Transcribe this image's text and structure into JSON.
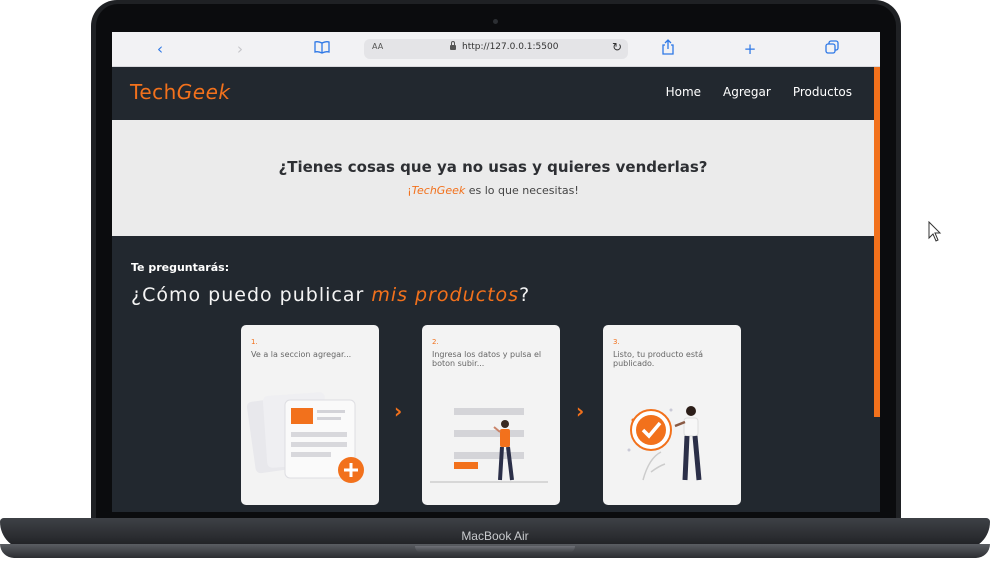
{
  "device": {
    "model_label": "MacBook Air"
  },
  "browser": {
    "url": "http://127.0.0.1:5500",
    "text_size_label": "AA",
    "icons": [
      "back-icon",
      "forward-icon",
      "book-icon",
      "lock-icon",
      "reload-icon",
      "share-icon",
      "new-tab-icon",
      "tabs-icon"
    ]
  },
  "site": {
    "logo_regular": "Tech",
    "logo_italic": "Geek",
    "nav": [
      "Home",
      "Agregar",
      "Productos"
    ],
    "hero": {
      "title": "¿Tienes cosas que ya no usas y quieres venderlas?",
      "sub_prefix": "¡",
      "sub_brand": "TechGeek",
      "sub_suffix": " es lo que necesitas!"
    },
    "section": {
      "kicker": "Te preguntarás:",
      "question_start": "¿Cómo puedo publicar ",
      "question_highlight": "mis productos",
      "question_end": "?"
    },
    "steps": [
      {
        "number": "1.",
        "text": "Ve a la seccion agregar..."
      },
      {
        "number": "2.",
        "text": "Ingresa los datos y pulsa el boton subir..."
      },
      {
        "number": "3.",
        "text": "Listo, tu producto está publicado."
      }
    ],
    "step_arrow": "›"
  },
  "colors": {
    "accent": "#f2711c",
    "dark": "#22282f",
    "hero_bg": "#ebebeb"
  }
}
